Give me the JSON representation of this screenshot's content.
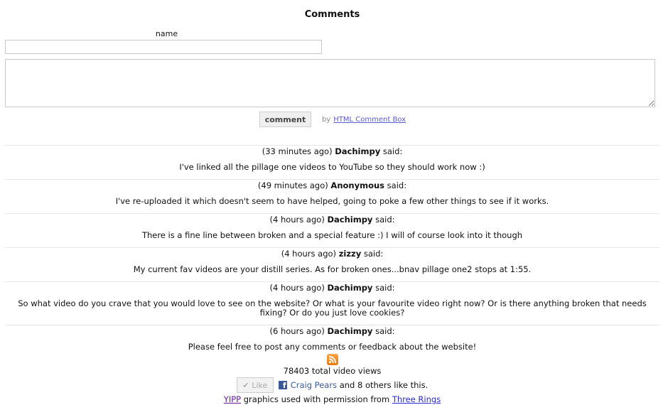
{
  "form": {
    "heading": "Comments",
    "name_label": "name",
    "name_value": "",
    "comment_value": "",
    "submit_label": "comment",
    "by_text": "by",
    "by_link": "HTML Comment Box"
  },
  "comments": [
    {
      "time": "(33 minutes ago)",
      "author": "Dachimpy",
      "said": "said:",
      "body": "I've linked all the pillage one videos to YouTube so they should work now :)"
    },
    {
      "time": "(49 minutes ago)",
      "author": "Anonymous",
      "said": "said:",
      "body": "I've re-uploaded it which doesn't seem to have helped, going to poke a few other things to see if it works."
    },
    {
      "time": "(4 hours ago)",
      "author": "Dachimpy",
      "said": "said:",
      "body": "There is a fine line between broken and a special feature :) I will of course look into it though"
    },
    {
      "time": "(4 hours ago)",
      "author": "zizzy",
      "said": "said:",
      "body": "My current fav videos are your distill series. As for broken ones...bnav pillage one2 stops at 1:55."
    },
    {
      "time": "(4 hours ago)",
      "author": "Dachimpy",
      "said": "said:",
      "body": "So what video do you crave that you would love to see on the website? Or what is your favourite video right now? Or is there anything broken that needs fixing? Or do you just love cookies?"
    },
    {
      "time": "(6 hours ago)",
      "author": "Dachimpy",
      "said": "said:",
      "body": "Please feel free to post any comments or feedback about the website!"
    }
  ],
  "footer": {
    "rss_icon": "rss-feed-icon",
    "views_text": "78403 total video views",
    "like_label": "Like",
    "like_person": "Craig Pears",
    "like_rest": " and 8 others like this.",
    "credit_link1": "YIPP",
    "credit_middle": " graphics used with permission from ",
    "credit_link2": "Three Rings"
  },
  "colors": {
    "link": "#5b5bd6",
    "facebook": "#3b5998",
    "rss": "#e8780f"
  }
}
